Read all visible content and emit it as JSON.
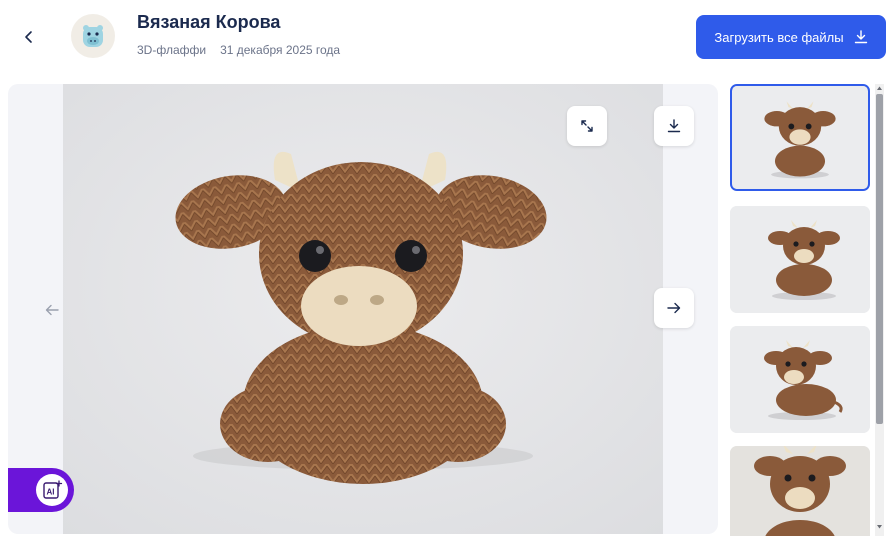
{
  "header": {
    "title": "Вязаная Корова",
    "category": "3D-флаффи",
    "date": "31 декабря 2025 года",
    "download_all_label": "Загрузить все файлы"
  },
  "icons": {
    "back": "chevron-left-icon",
    "download": "download-icon",
    "fullscreen": "expand-icon",
    "prev": "arrow-left-icon",
    "next": "arrow-right-icon",
    "ai": "ai-icon"
  },
  "ai_badge": {
    "label": "AI"
  },
  "thumbnails": {
    "count": 4,
    "selected": 1
  },
  "colors": {
    "accent": "#2f5bea",
    "ai_badge": "#6b15d9",
    "title": "#1b2a4e",
    "knit": "#8a5a3a",
    "muzzle": "#ecdcc0"
  }
}
